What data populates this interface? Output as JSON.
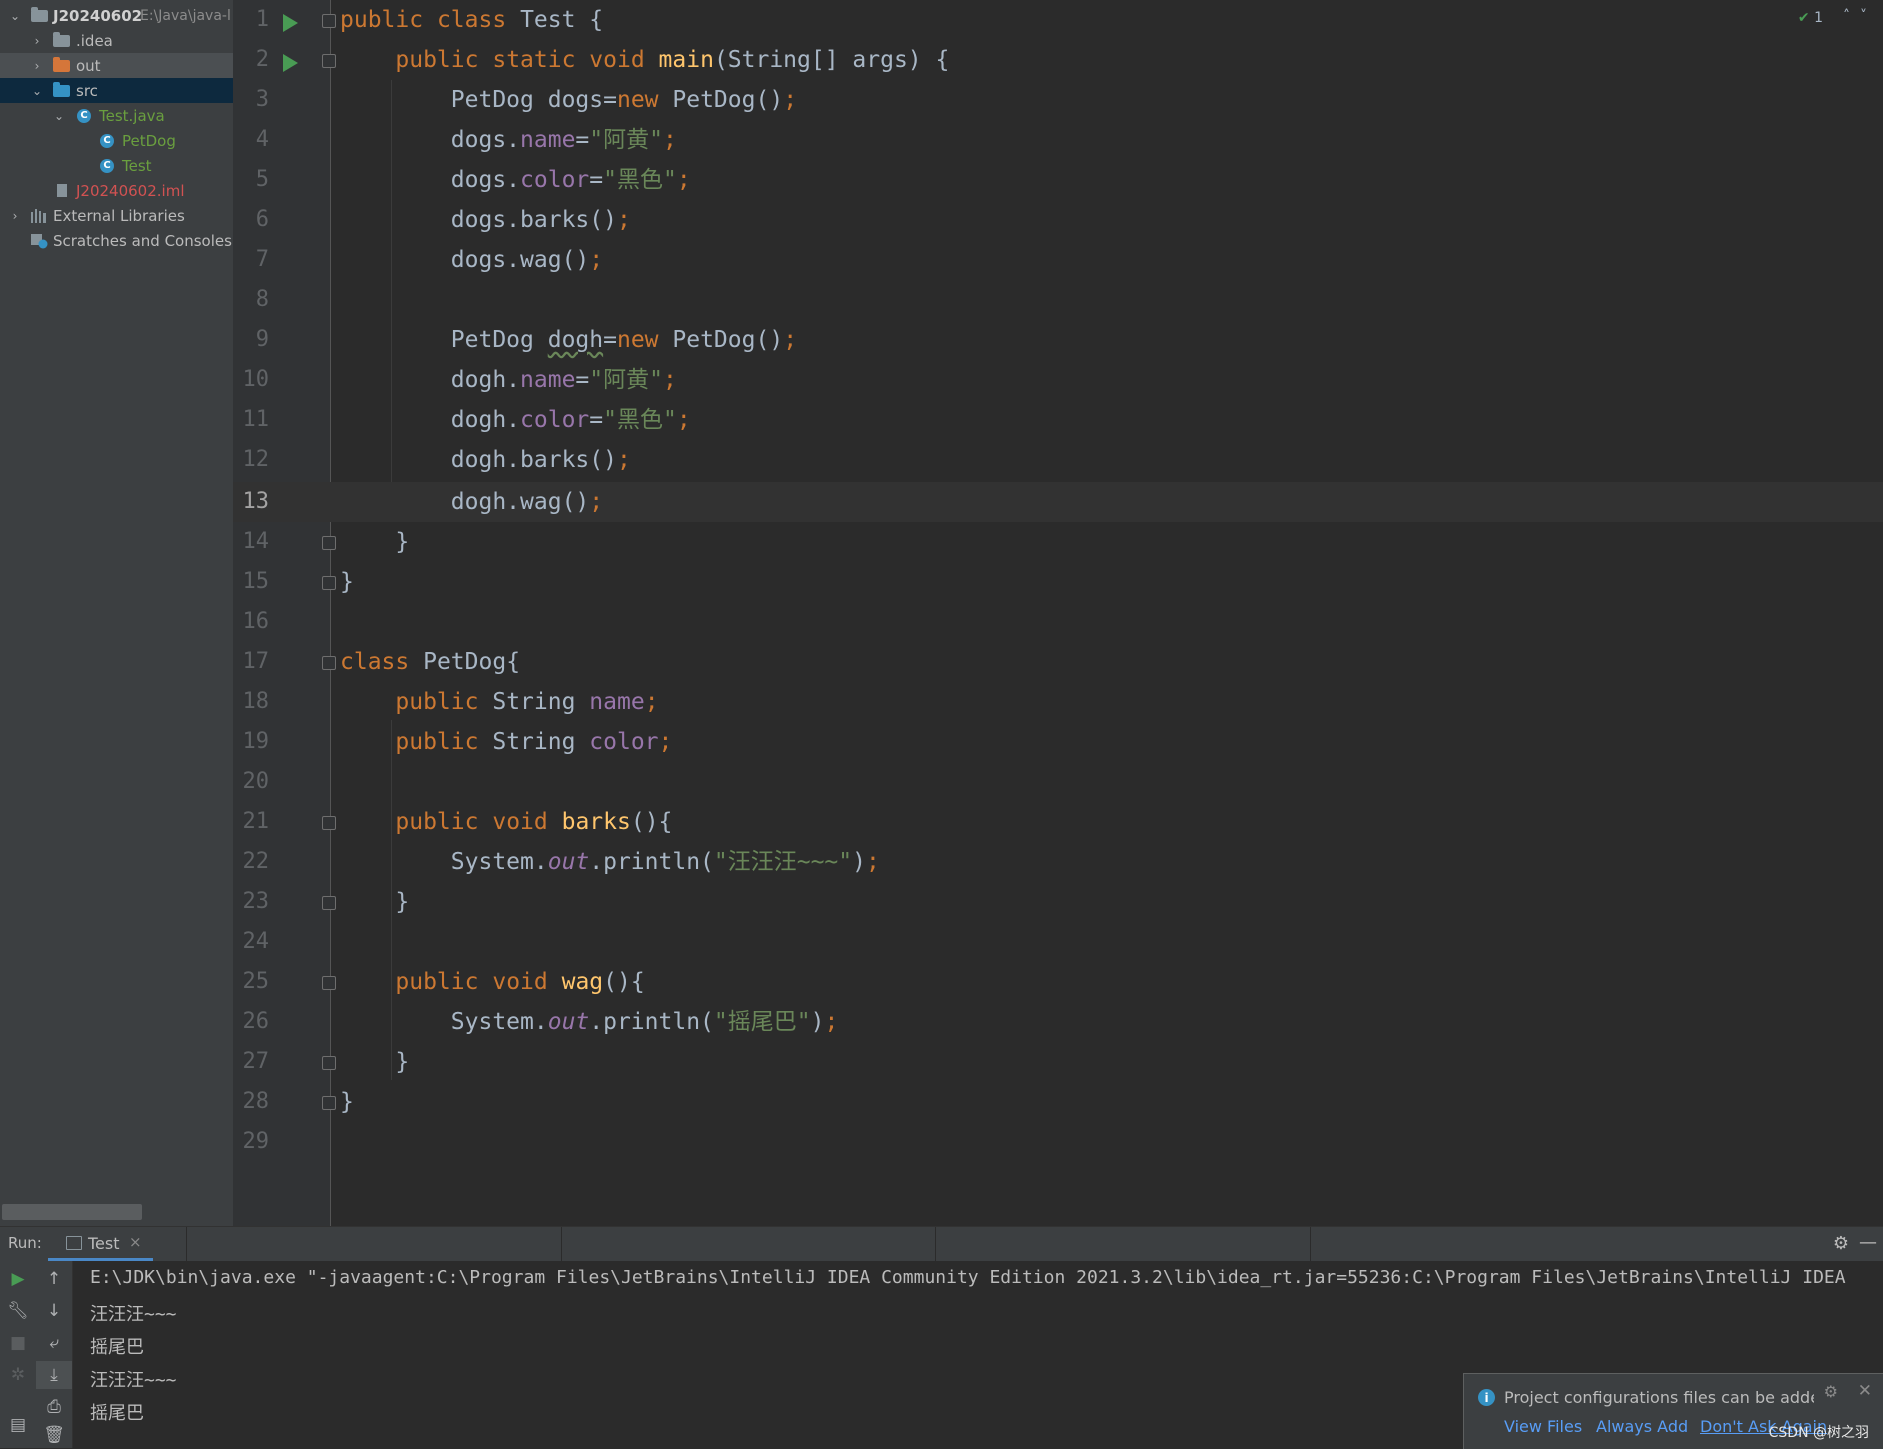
{
  "project": {
    "root_name": "J20240602",
    "root_path": "E:\\Java\\java-l",
    "items": [
      {
        "label": "J20240602",
        "path": "E:\\Java\\java-l"
      },
      {
        "label": ".idea"
      },
      {
        "label": "out"
      },
      {
        "label": "src"
      },
      {
        "label": "Test.java"
      },
      {
        "label": "PetDog"
      },
      {
        "label": "Test"
      },
      {
        "label": "J20240602.iml"
      },
      {
        "label": "External Libraries"
      },
      {
        "label": "Scratches and Consoles"
      }
    ]
  },
  "editor": {
    "inspections": "1",
    "current_line": 13,
    "line_numbers": [
      "1",
      "2",
      "3",
      "4",
      "5",
      "6",
      "7",
      "8",
      "9",
      "10",
      "11",
      "12",
      "13",
      "14",
      "15",
      "16",
      "17",
      "18",
      "19",
      "20",
      "21",
      "22",
      "23",
      "24",
      "25",
      "26",
      "27",
      "28",
      "29"
    ],
    "tokens": {
      "public": "public",
      "class": "class",
      "static": "static",
      "void": "void",
      "new": "new",
      "Test": "Test",
      "main": "main",
      "args": "(String[] args) {",
      "PetDog": "PetDog",
      "PetDog_brace": "PetDog{",
      "dogs": "dogs",
      "dogh": "dogh",
      "name": "name",
      "color": "color",
      "String": "String",
      "barks": "barks",
      "wag": "wag",
      "System": "System.",
      "out": "out",
      "println": ".println(",
      "str_ahuang": "\"阿黄\"",
      "str_heise": "\"黑色\"",
      "str_wang": "\"汪汪汪~~~\"",
      "str_yao": "\"摇尾巴\""
    }
  },
  "run_panel": {
    "label": "Run:",
    "tab": "Test",
    "console": [
      "E:\\JDK\\bin\\java.exe \"-javaagent:C:\\Program Files\\JetBrains\\IntelliJ IDEA Community Edition 2021.3.2\\lib\\idea_rt.jar=55236:C:\\Program Files\\JetBrains\\IntelliJ IDEA",
      "汪汪汪~~~",
      "摇尾巴",
      "汪汪汪~~~",
      "摇尾巴"
    ]
  },
  "notification": {
    "text": "Project configurations files can be added t",
    "links": [
      "View Files",
      "Always Add",
      "Don't Ask Again"
    ]
  },
  "watermark": "CSDN @树之羽",
  "colors": {
    "keyword": "#cc7832",
    "function": "#ffc66d",
    "field": "#9876aa",
    "string": "#6a8759",
    "text": "#a9b7c6",
    "run_green": "#499c54"
  }
}
